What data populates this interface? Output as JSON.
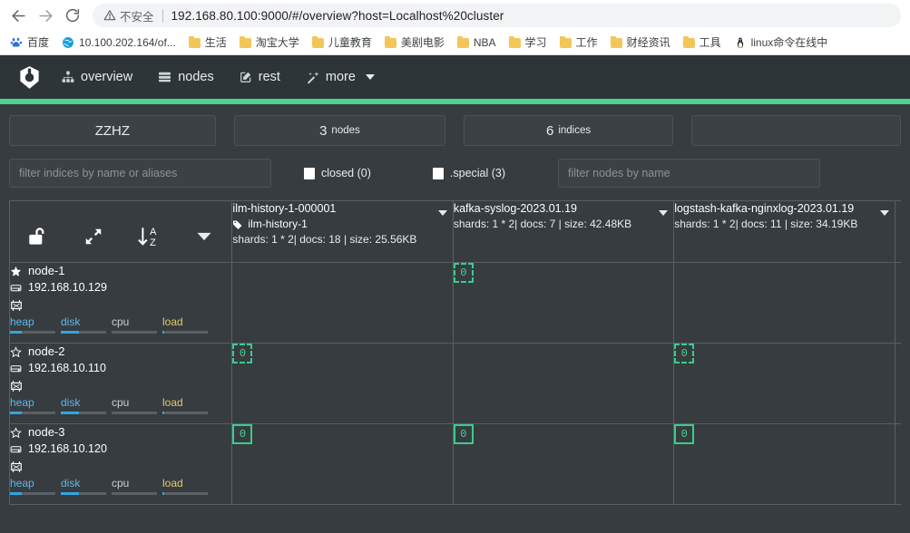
{
  "browser": {
    "back_icon": "back-arrow-icon",
    "forward_icon": "forward-arrow-icon",
    "reload_icon": "reload-icon",
    "security_label": "不安全",
    "url": "192.168.80.100:9000/#/overview?host=Localhost%20cluster",
    "bookmarks": [
      {
        "label": "百度",
        "icon": "baidu-icon"
      },
      {
        "label": "10.100.202.164/of...",
        "icon": "globe-icon"
      },
      {
        "label": "生活",
        "icon": "folder-icon"
      },
      {
        "label": "淘宝大学",
        "icon": "folder-icon"
      },
      {
        "label": "儿童教育",
        "icon": "folder-icon"
      },
      {
        "label": "美剧电影",
        "icon": "folder-icon"
      },
      {
        "label": "NBA",
        "icon": "folder-icon"
      },
      {
        "label": "学习",
        "icon": "folder-icon"
      },
      {
        "label": "工作",
        "icon": "folder-icon"
      },
      {
        "label": "财经资讯",
        "icon": "folder-icon"
      },
      {
        "label": "工具",
        "icon": "folder-icon"
      },
      {
        "label": "linux命令在线中",
        "icon": "linux-penguin-icon"
      }
    ]
  },
  "navbar": {
    "brand_icon": "cerebro-logo-icon",
    "items": [
      {
        "label": "overview",
        "icon": "sitemap-icon"
      },
      {
        "label": "nodes",
        "icon": "server-icon"
      },
      {
        "label": "rest",
        "icon": "edit-icon"
      },
      {
        "label": "more",
        "icon": "magic-wand-icon",
        "has_caret": true
      }
    ],
    "accent_color": "#4cd291"
  },
  "cards": [
    {
      "title": "ZZHZ",
      "number": "",
      "label": ""
    },
    {
      "title": "",
      "number": "3",
      "label": "nodes"
    },
    {
      "title": "",
      "number": "6",
      "label": "indices"
    },
    {
      "title": "",
      "number": "",
      "label": ""
    }
  ],
  "filters": {
    "indices_placeholder": "filter indices by name or aliases",
    "closed_label": "closed (0)",
    "special_label": ".special (3)",
    "nodes_placeholder": "filter nodes by name"
  },
  "toolbar": [
    {
      "name": "unlock-icon",
      "title": "unlock"
    },
    {
      "name": "expand-icon",
      "title": "expand"
    },
    {
      "name": "sort-az-icon",
      "title": "sort a-z"
    },
    {
      "name": "chevron-down-icon",
      "title": "more"
    }
  ],
  "indices": [
    {
      "name": "ilm-history-1-000001",
      "alias": "ilm-history-1",
      "meta": "shards: 1 * 2| docs: 18 | size: 25.56KB"
    },
    {
      "name": "kafka-syslog-2023.01.19",
      "alias": "",
      "meta": "shards: 1 * 2| docs: 7 | size: 42.48KB"
    },
    {
      "name": "logstash-kafka-nginxlog-2023.01.19",
      "alias": "",
      "meta": "shards: 1 * 2| docs: 11 | size: 34.19KB"
    },
    {
      "name": "",
      "alias": "",
      "meta": ""
    }
  ],
  "nodes": [
    {
      "name": "node-1",
      "ip": "192.168.10.129",
      "master": true,
      "stats": [
        {
          "label": "heap",
          "pct": 25
        },
        {
          "label": "disk",
          "pct": 40
        },
        {
          "label": "cpu",
          "pct": 0
        },
        {
          "label": "load",
          "pct": 3
        }
      ],
      "shards": [
        null,
        {
          "value": "0",
          "type": "replica"
        },
        null,
        null
      ]
    },
    {
      "name": "node-2",
      "ip": "192.168.10.110",
      "master": false,
      "stats": [
        {
          "label": "heap",
          "pct": 25
        },
        {
          "label": "disk",
          "pct": 40
        },
        {
          "label": "cpu",
          "pct": 0
        },
        {
          "label": "load",
          "pct": 3
        }
      ],
      "shards": [
        {
          "value": "0",
          "type": "replica"
        },
        null,
        {
          "value": "0",
          "type": "replica"
        },
        null
      ]
    },
    {
      "name": "node-3",
      "ip": "192.168.10.120",
      "master": false,
      "stats": [
        {
          "label": "heap",
          "pct": 25
        },
        {
          "label": "disk",
          "pct": 40
        },
        {
          "label": "cpu",
          "pct": 0
        },
        {
          "label": "load",
          "pct": 3
        }
      ],
      "shards": [
        {
          "value": "0",
          "type": "primary"
        },
        {
          "value": "0",
          "type": "primary"
        },
        {
          "value": "0",
          "type": "primary"
        },
        null
      ]
    }
  ]
}
